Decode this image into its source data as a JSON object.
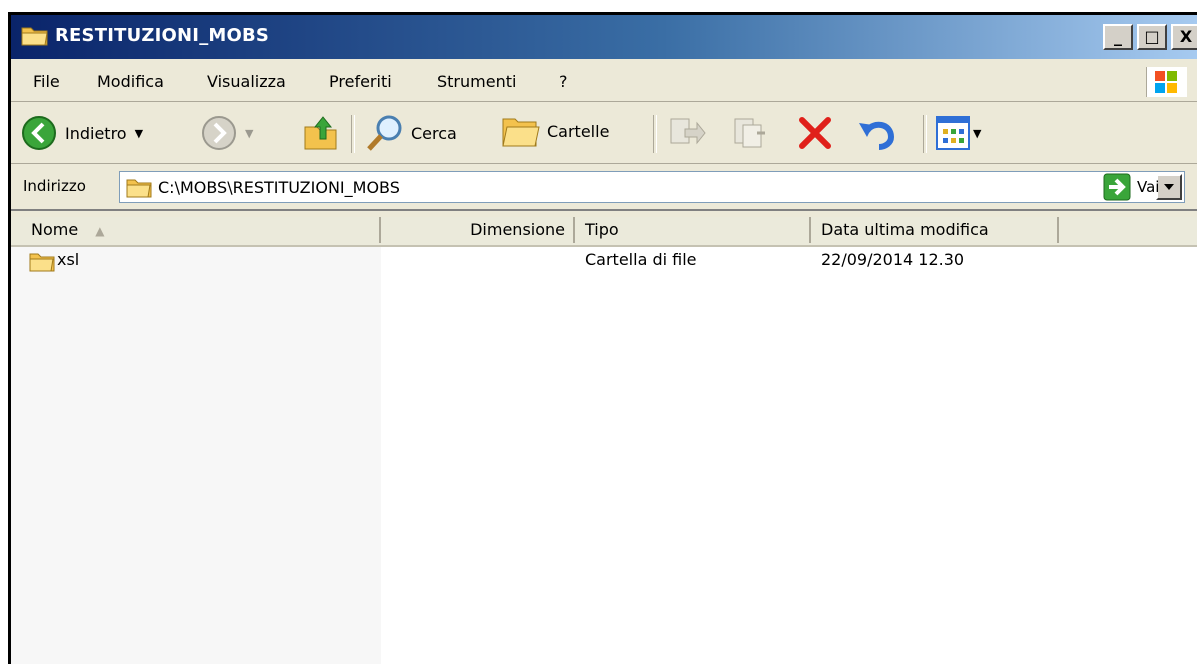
{
  "window": {
    "title": "RESTITUZIONI_MOBS"
  },
  "window_buttons": {
    "minimize": "_",
    "maximize": "□",
    "close": "X"
  },
  "menu": [
    "File",
    "Modifica",
    "Visualizza",
    "Preferiti",
    "Strumenti",
    "?"
  ],
  "toolbar": {
    "back_label": "Indietro",
    "search_label": "Cerca",
    "folders_label": "Cartelle"
  },
  "address": {
    "label": "Indirizzo",
    "path": "C:\\MOBS\\RESTITUZIONI_MOBS",
    "go_label": "Vai"
  },
  "columns": {
    "name": "Nome",
    "size": "Dimensione",
    "type": "Tipo",
    "modified": "Data ultima modifica"
  },
  "files": [
    {
      "name": "xsl",
      "size": "",
      "type": "Cartella di file",
      "modified": "22/09/2014 12.30"
    }
  ],
  "colors": {
    "title_gradient_start": "#0a246a",
    "title_gradient_end": "#a6caf0",
    "chrome": "#ece9d8"
  }
}
